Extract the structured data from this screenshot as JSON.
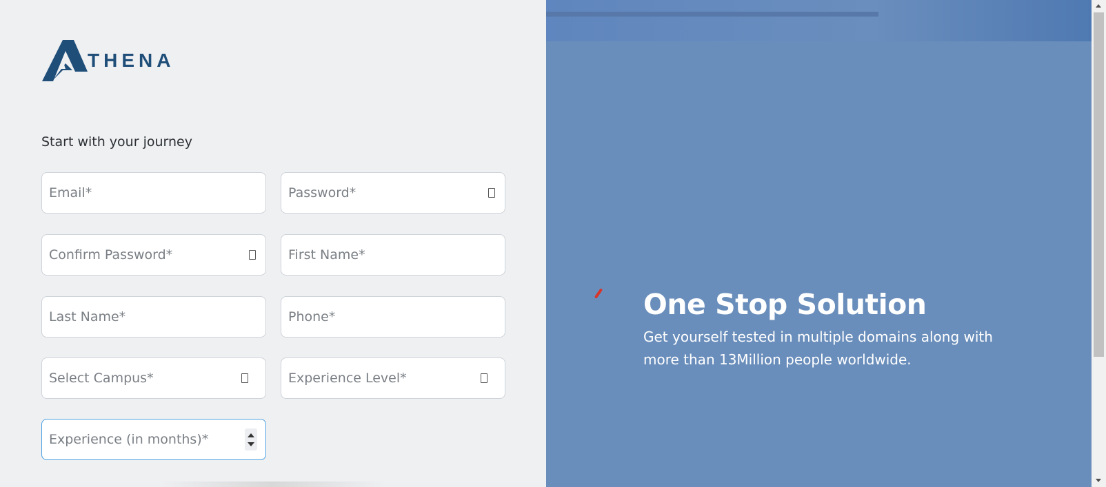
{
  "brand": {
    "name": "THENA",
    "logo_icon": "athena-logo-icon",
    "color": "#1f4e79"
  },
  "form": {
    "heading": "Start with your journey",
    "fields": {
      "email": {
        "placeholder": "Email*"
      },
      "password": {
        "placeholder": "Password*",
        "icon": "password-toggle-icon"
      },
      "confirm_password": {
        "placeholder": "Confirm Password*",
        "icon": "password-toggle-icon"
      },
      "first_name": {
        "placeholder": "First Name*"
      },
      "last_name": {
        "placeholder": "Last Name*"
      },
      "phone": {
        "placeholder": "Phone*"
      },
      "campus": {
        "placeholder": "Select Campus*",
        "icon": "dropdown-icon"
      },
      "experience_level": {
        "placeholder": "Experience Level*",
        "icon": "dropdown-icon"
      },
      "experience_months": {
        "placeholder": "Experience (in months)*",
        "icon": "number-spinner"
      }
    },
    "focus_color": "#4b9fe0"
  },
  "hero": {
    "title": "One Stop Solution",
    "description": "Get yourself tested in multiple domains along with more than 13Million people worldwide.",
    "background": "#6a8ebb",
    "loader_color": "#d9342a"
  }
}
